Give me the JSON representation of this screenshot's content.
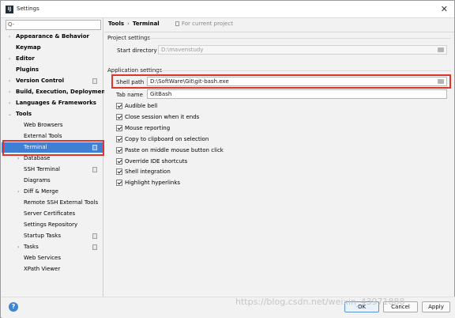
{
  "window": {
    "title": "Settings",
    "app_icon": "intellij-app-icon"
  },
  "search": {
    "placeholder": "Q-",
    "value": ""
  },
  "sidebar": {
    "items": [
      {
        "label": "Appearance & Behavior",
        "arrow": "›"
      },
      {
        "label": "Keymap"
      },
      {
        "label": "Editor",
        "arrow": "›"
      },
      {
        "label": "Plugins"
      },
      {
        "label": "Version Control",
        "arrow": "›"
      },
      {
        "label": "Build, Execution, Deployment",
        "arrow": "›"
      },
      {
        "label": "Languages & Frameworks",
        "arrow": "›"
      },
      {
        "label": "Tools",
        "arrow": "⌄"
      },
      {
        "label": "Web Browsers"
      },
      {
        "label": "External Tools"
      },
      {
        "label": "Terminal"
      },
      {
        "label": "Database",
        "arrow": "›"
      },
      {
        "label": "SSH Terminal"
      },
      {
        "label": "Diagrams"
      },
      {
        "label": "Diff & Merge",
        "arrow": "›"
      },
      {
        "label": "Remote SSH External Tools"
      },
      {
        "label": "Server Certificates"
      },
      {
        "label": "Settings Repository"
      },
      {
        "label": "Startup Tasks"
      },
      {
        "label": "Tasks",
        "arrow": "›"
      },
      {
        "label": "Web Services"
      },
      {
        "label": "XPath Viewer"
      }
    ]
  },
  "breadcrumb": {
    "parent": "Tools",
    "separator": "›",
    "current": "Terminal",
    "scope": "For current project"
  },
  "project_settings": {
    "heading": "Project settings",
    "start_directory_label": "Start directory",
    "start_directory_value": "D:\\mavenstudy"
  },
  "application_settings": {
    "heading": "Application settings",
    "shell_path_label": "Shell path",
    "shell_path_value": "D:\\SoftWare\\Git\\git-bash.exe",
    "tab_name_label": "Tab name",
    "tab_name_value": "GitBash",
    "checkboxes": [
      {
        "label": "Audible bell",
        "checked": true
      },
      {
        "label": "Close session when it ends",
        "checked": true
      },
      {
        "label": "Mouse reporting",
        "checked": true
      },
      {
        "label": "Copy to clipboard on selection",
        "checked": true
      },
      {
        "label": "Paste on middle mouse button click",
        "checked": true
      },
      {
        "label": "Override IDE shortcuts",
        "checked": true
      },
      {
        "label": "Shell integration",
        "checked": true
      },
      {
        "label": "Highlight hyperlinks",
        "checked": true
      }
    ]
  },
  "footer": {
    "help": "?",
    "ok": "OK",
    "cancel": "Cancel",
    "apply": "Apply"
  },
  "watermark": "https://blog.csdn.net/weixin_43971888",
  "colors": {
    "selection": "#3f7fd4",
    "highlight_box": "#e0332c"
  }
}
